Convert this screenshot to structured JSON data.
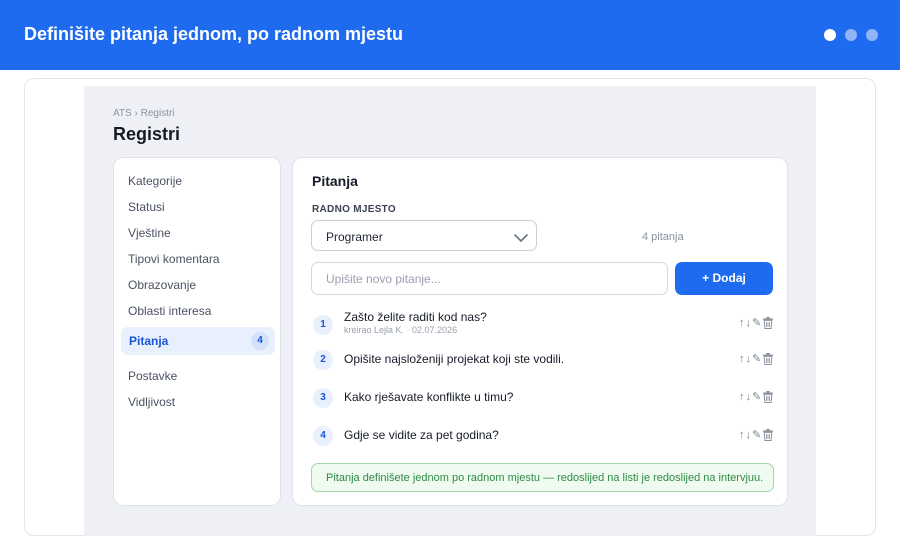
{
  "banner": {
    "title": "Definišite pitanja jednom, po radnom mjestu",
    "dots": 3,
    "active_dot": 0
  },
  "header": {
    "breadcrumb": "ATS › Registri",
    "title": "Registri"
  },
  "sidebar": {
    "items": [
      {
        "label": "Kategorije"
      },
      {
        "label": "Statusi"
      },
      {
        "label": "Vještine"
      },
      {
        "label": "Tipovi komentara"
      },
      {
        "label": "Obrazovanje"
      },
      {
        "label": "Oblasti interesa"
      },
      {
        "label": "Pitanja",
        "badge": "4",
        "active": true
      },
      {
        "label": "Postavke"
      },
      {
        "label": "Vidljivost"
      }
    ]
  },
  "panel": {
    "title": "Pitanja",
    "field_label": "RADNO MJESTO",
    "select_value": "Programer",
    "count": "4 pitanja",
    "input_placeholder": "Upišite novo pitanje...",
    "add_label": "+ Dodaj",
    "questions": [
      {
        "num": "1",
        "text": "Zašto želite raditi kod nas?",
        "meta": "kreirao Lejla K. · 02.07.2026"
      },
      {
        "num": "2",
        "text": "Opišite najsloženiji projekat koji ste vodili.",
        "meta": ""
      },
      {
        "num": "3",
        "text": "Kako rješavate konflikte u timu?",
        "meta": ""
      },
      {
        "num": "4",
        "text": "Gdje se vidite za pet godina?",
        "meta": ""
      }
    ],
    "actions": {
      "up": "↑",
      "down": "↓",
      "edit": "✎"
    },
    "note": "Pitanja definišete jednom po radnom mjestu — redoslijed na listi je redoslijed na intervjuu."
  },
  "colors": {
    "accent": "#1f6bf0",
    "success_bg": "#effaf1",
    "success_text": "#2f8a45"
  },
  "icons": [
    "chevron-down-icon",
    "arrow-up-icon",
    "arrow-down-icon",
    "pencil-icon",
    "trash-icon"
  ]
}
